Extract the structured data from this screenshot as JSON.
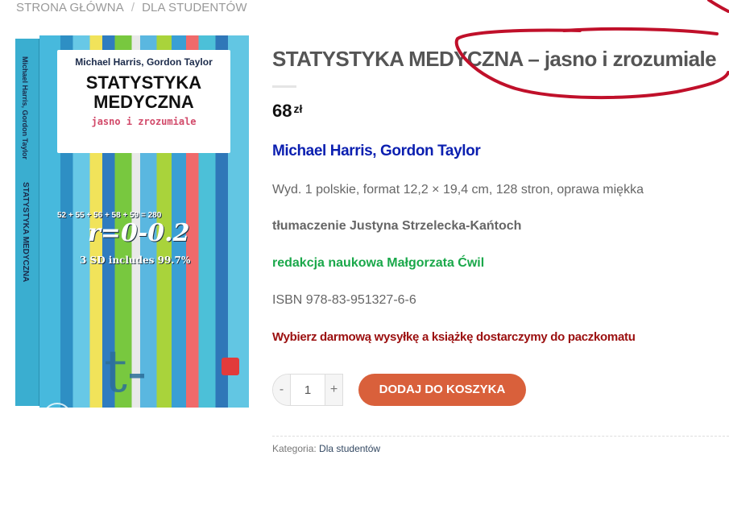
{
  "breadcrumb": {
    "home": "STRONA GŁÓWNA",
    "separator": "/",
    "current": "DLA STUDENTÓW"
  },
  "product_image": {
    "spine_authors": "Michael Harris, Gordon Taylor",
    "spine_title": "STATYSTYKA MEDYCZNA",
    "cover_authors": "Michael Harris, Gordon Taylor",
    "cover_title_line1": "STATYSTYKA",
    "cover_title_line2": "MEDYCZNA",
    "cover_subtitle": "jasno i zrozumiale",
    "cover_sum": "52 + 55 + 56 + 58 + 59 = 280",
    "cover_formula": "r=0-0.2",
    "cover_sd": "3 SD includes 99.7%",
    "cover_ttest": "t-test",
    "zoom_icon": "⤢"
  },
  "product": {
    "title": "STATYSTYKA MEDYCZNA – jasno i zrozumiale",
    "price_value": "68",
    "price_currency": "zł",
    "authors": "Michael Harris, Gordon Taylor",
    "edition": "Wyd. 1 polskie, format 12,2 × 19,4 cm, 128 stron, oprawa miękka",
    "translation": "tłumaczenie Justyna Strzelecka-Kańtoch",
    "editor": "redakcja naukowa Małgorzata Ćwil",
    "isbn": "ISBN 978-83-951327-6-6",
    "shipping_note": "Wybierz darmową wysyłkę a książkę dostarczymy do paczkomatu"
  },
  "cart": {
    "minus": "-",
    "quantity": "1",
    "plus": "+",
    "add_to_cart": "DODAJ DO KOSZYKA"
  },
  "meta": {
    "category_label": "Kategoria:",
    "category_link": "Dla studentów"
  },
  "colors": {
    "annotation": "#c0102a",
    "authors": "#0b1fb0",
    "editor": "#1aa84a",
    "shipping": "#9b0f0f",
    "button": "#d9603b"
  }
}
